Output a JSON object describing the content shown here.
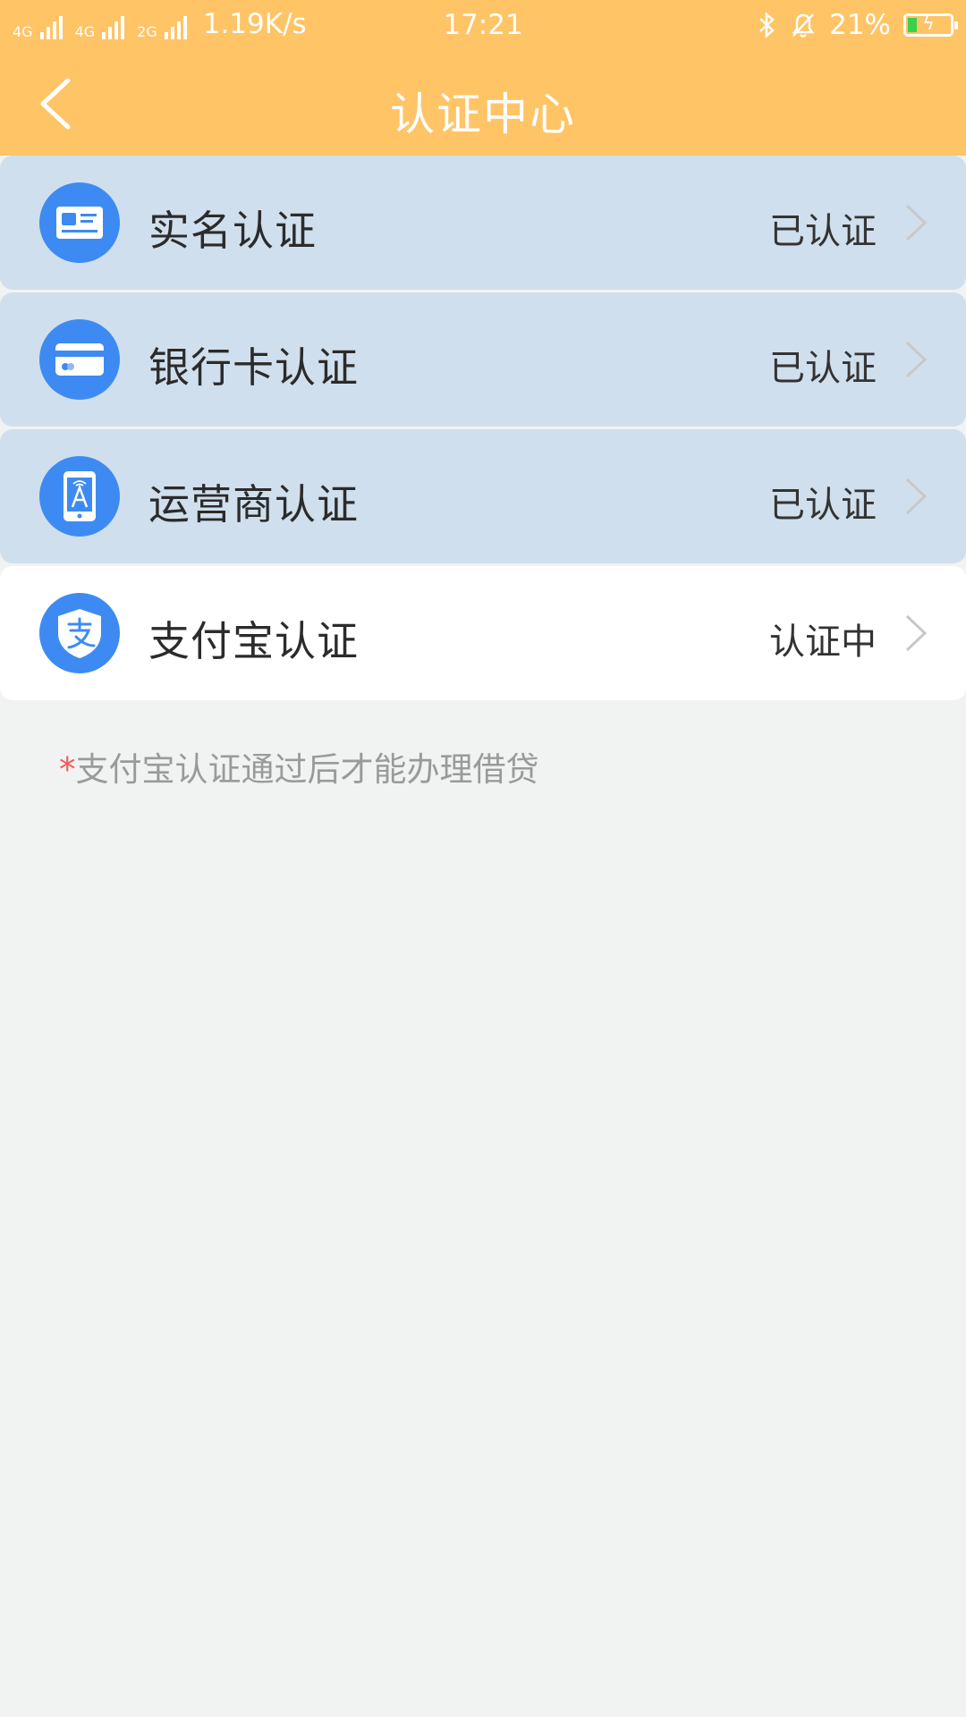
{
  "status_bar": {
    "network_1": "4G",
    "network_2": "4G",
    "network_3": "2G",
    "speed": "1.19K/s",
    "time": "17:21",
    "battery": "21%",
    "battery_level": 0.21
  },
  "header": {
    "title": "认证中心",
    "background_color": "#ffc466"
  },
  "items": [
    {
      "label": "实名认证",
      "status": "已认证",
      "icon": "id-card-icon",
      "state": "done"
    },
    {
      "label": "银行卡认证",
      "status": "已认证",
      "icon": "bank-card-icon",
      "state": "done"
    },
    {
      "label": "运营商认证",
      "status": "已认证",
      "icon": "carrier-phone-icon",
      "state": "done"
    },
    {
      "label": "支付宝认证",
      "status": "认证中",
      "icon": "alipay-shield-icon",
      "state": "pending"
    }
  ],
  "note": {
    "marker": "*",
    "text": "支付宝认证通过后才能办理借贷"
  },
  "colors": {
    "accent": "#3d8bf2",
    "verified_bg": "#d0dfed",
    "page_bg": "#f1f3f3",
    "required_marker": "#f05a5a"
  }
}
